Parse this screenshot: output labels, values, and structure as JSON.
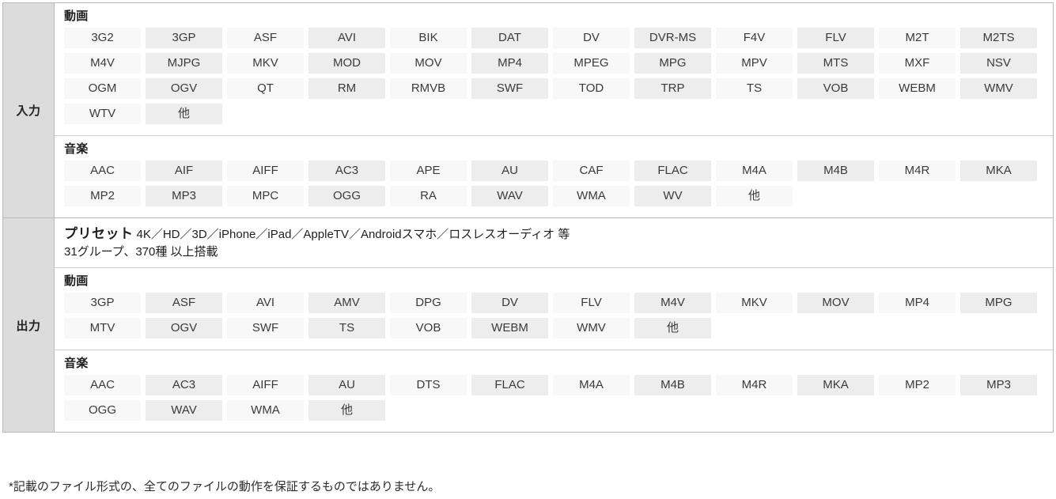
{
  "sections": [
    {
      "label": "入力",
      "groups": [
        {
          "title": "動画",
          "tags": [
            "3G2",
            "3GP",
            "ASF",
            "AVI",
            "BIK",
            "DAT",
            "DV",
            "DVR-MS",
            "F4V",
            "FLV",
            "M2T",
            "M2TS",
            "M4V",
            "MJPG",
            "MKV",
            "MOD",
            "MOV",
            "MP4",
            "MPEG",
            "MPG",
            "MPV",
            "MTS",
            "MXF",
            "NSV",
            "OGM",
            "OGV",
            "QT",
            "RM",
            "RMVB",
            "SWF",
            "TOD",
            "TRP",
            "TS",
            "VOB",
            "WEBM",
            "WMV",
            "WTV",
            "他"
          ]
        },
        {
          "title": "音楽",
          "tags": [
            "AAC",
            "AIF",
            "AIFF",
            "AC3",
            "APE",
            "AU",
            "CAF",
            "FLAC",
            "M4A",
            "M4B",
            "M4R",
            "MKA",
            "MP2",
            "MP3",
            "MPC",
            "OGG",
            "RA",
            "WAV",
            "WMA",
            "WV",
            "他"
          ]
        }
      ]
    },
    {
      "label": "出力",
      "preset": {
        "strong": "プリセット",
        "line1": "4K／HD／3D／iPhone／iPad／AppleTV／Androidスマホ／ロスレスオーディオ 等",
        "line2": "31グループ、370種 以上搭載"
      },
      "groups": [
        {
          "title": "動画",
          "tags": [
            "3GP",
            "ASF",
            "AVI",
            "AMV",
            "DPG",
            "DV",
            "FLV",
            "M4V",
            "MKV",
            "MOV",
            "MP4",
            "MPG",
            "MTV",
            "OGV",
            "SWF",
            "TS",
            "VOB",
            "WEBM",
            "WMV",
            "他"
          ]
        },
        {
          "title": "音楽",
          "tags": [
            "AAC",
            "AC3",
            "AIFF",
            "AU",
            "DTS",
            "FLAC",
            "M4A",
            "M4B",
            "M4R",
            "MKA",
            "MP2",
            "MP3",
            "OGG",
            "WAV",
            "WMA",
            "他"
          ]
        }
      ]
    }
  ],
  "footnote": "*記載のファイル形式の、全てのファイルの動作を保証するものではありません。",
  "colors": {
    "label_bg": "#dcdcdc",
    "tag_bg": "#f8f8f8",
    "tag_bg_alt": "#ededed",
    "border": "#b9b9b9",
    "inner_border": "#cfcfcf"
  }
}
